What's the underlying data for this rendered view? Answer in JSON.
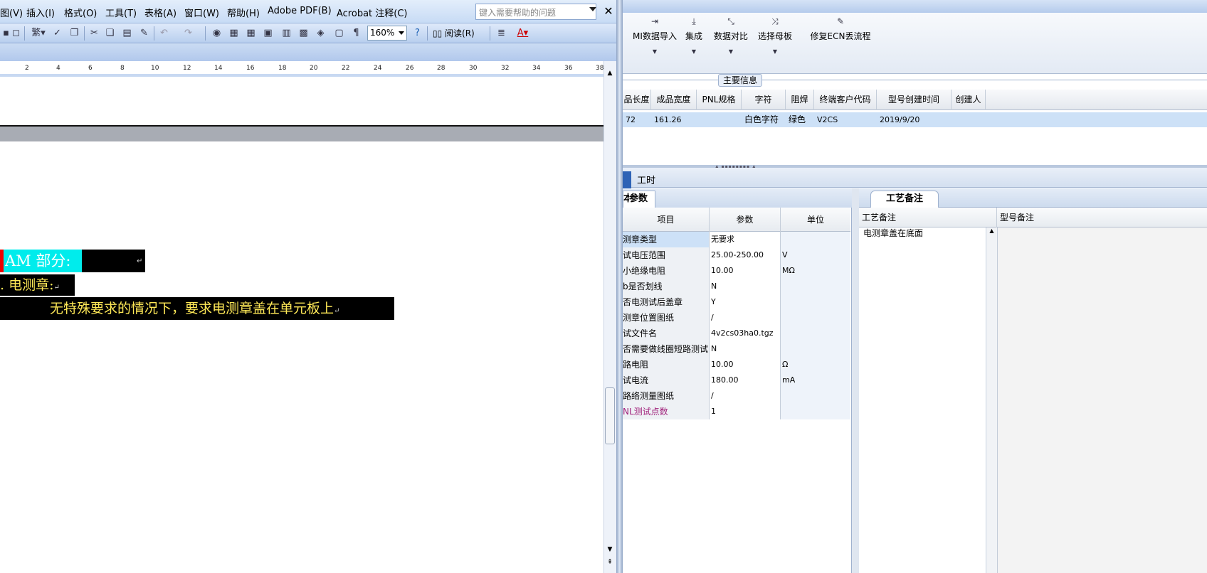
{
  "word": {
    "menus": [
      "图(V)",
      "插入(I)",
      "格式(O)",
      "工具(T)",
      "表格(A)",
      "窗口(W)",
      "帮助(H)",
      "Adobe PDF(B)",
      "Acrobat 注释(C)"
    ],
    "help_placeholder": "键入需要帮助的问题",
    "close_glyph": "✕",
    "zoom": "160%",
    "read_label": "阅读(R)",
    "ruler_numbers": [
      "2",
      "4",
      "6",
      "8",
      "10",
      "12",
      "14",
      "16",
      "18",
      "20",
      "22",
      "24",
      "26",
      "28",
      "30",
      "32",
      "34",
      "36",
      "38"
    ],
    "doc": {
      "heading1": "AM 部分:",
      "heading2": ". 电测章:",
      "body": "无特殊要求的情况下，要求电测章盖在单元板上",
      "para_mark": "↵"
    }
  },
  "app": {
    "ribbon": [
      {
        "label": "MI数据导入",
        "icon": "import-icon"
      },
      {
        "label": "集成",
        "icon": "download-icon"
      },
      {
        "label": "数据对比",
        "icon": "compare-icon"
      },
      {
        "label": "选择母板",
        "icon": "shuffle-icon"
      },
      {
        "label": "修复ECN丢流程",
        "icon": "wrench-icon"
      }
    ],
    "main_info_title": "主要信息",
    "main_columns": [
      "品长度",
      "成品宽度",
      "PNL规格",
      "字符",
      "阻焊",
      "终端客户代码",
      "型号创建时间",
      "创建人"
    ],
    "main_row": [
      "72",
      "161.26",
      "",
      "白色字符",
      "绿色",
      "V2CS",
      "2019/9/20",
      ""
    ],
    "worktab": "工时",
    "params_tab": "参数",
    "params_columns": [
      "项目",
      "参数",
      "单位"
    ],
    "params_rows": [
      {
        "item": "测章类型",
        "value": "无要求",
        "unit": ""
      },
      {
        "item": "试电压范围",
        "value": "25.00-250.00",
        "unit": "V"
      },
      {
        "item": "小绝缘电阻",
        "value": "10.00",
        "unit": "MΩ"
      },
      {
        "item": "b是否划线",
        "value": "N",
        "unit": ""
      },
      {
        "item": "否电测试后盖章",
        "value": "Y",
        "unit": ""
      },
      {
        "item": "测章位置图纸",
        "value": "/",
        "unit": ""
      },
      {
        "item": "试文件名",
        "value": "4v2cs03ha0.tgz",
        "unit": ""
      },
      {
        "item": "否需要做线圈短路测试",
        "value": "N",
        "unit": ""
      },
      {
        "item": "路电阻",
        "value": "10.00",
        "unit": "Ω"
      },
      {
        "item": "试电流",
        "value": "180.00",
        "unit": "mA"
      },
      {
        "item": "路络测量图纸",
        "value": "/",
        "unit": ""
      },
      {
        "item": "NL测试点数",
        "value": "1",
        "unit": ""
      }
    ],
    "craft_tab": "工艺备注",
    "craft_columns": [
      "工艺备注",
      "型号备注"
    ],
    "craft_note": "电测章盖在底面"
  }
}
